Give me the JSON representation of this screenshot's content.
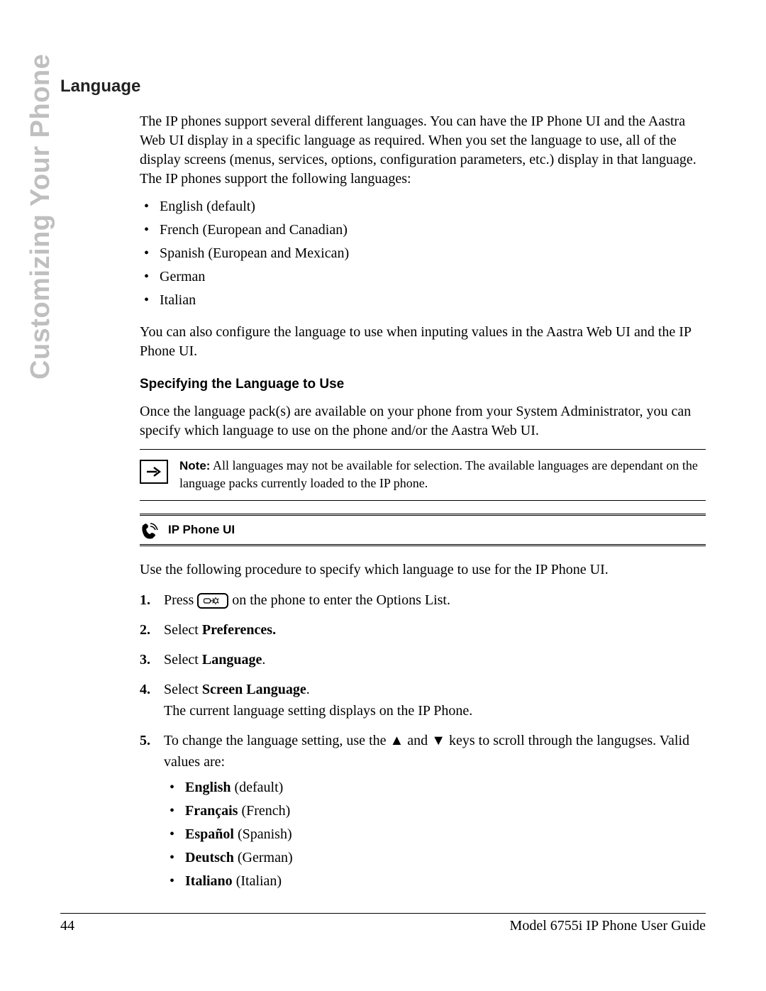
{
  "sidebar": {
    "title": "Customizing Your Phone"
  },
  "section": {
    "title": "Language",
    "intro": "The IP phones support several different languages. You can have the IP Phone UI and the Aastra Web UI display in a specific language as required. When you set the language to use, all of the display screens (menus, services, options, configuration parameters, etc.) display in that language. The IP phones support the following languages:",
    "lang_list": [
      "English (default)",
      "French (European and Canadian)",
      "Spanish (European and Mexican)",
      "German",
      "Italian"
    ],
    "post_list_para": "You can also configure the language to use when inputing values in the Aastra Web UI and the IP Phone UI."
  },
  "specify": {
    "heading": "Specifying the Language to Use",
    "para": "Once the language pack(s) are available on your phone from your System Administrator, you can specify which language to use on the phone and/or the Aastra Web UI."
  },
  "note": {
    "label": "Note:",
    "text": " All languages may not be available for selection. The available languages are dependant on the language packs currently loaded to the IP phone."
  },
  "ui_band": {
    "label": "IP Phone UI"
  },
  "procedure": {
    "intro": "Use the following procedure to specify which language to use for the IP Phone UI.",
    "steps": {
      "s1_pre": "Press ",
      "s1_post": " on the phone to enter the Options List.",
      "s2_pre": "Select ",
      "s2_bold": "Preferences.",
      "s3_pre": "Select ",
      "s3_bold": "Language",
      "s3_post": ".",
      "s4_pre": "Select ",
      "s4_bold": "Screen Language",
      "s4_post": ".",
      "s4_line2": "The current language setting displays on the IP Phone.",
      "s5_pre": "To change the language setting, use the ",
      "s5_mid": " and ",
      "s5_post": " keys to scroll through the langugses. Valid values are:",
      "values": [
        {
          "bold": "English",
          "rest": " (default)"
        },
        {
          "bold": "Français",
          "rest": " (French)"
        },
        {
          "bold": "Español",
          "rest": " (Spanish)"
        },
        {
          "bold": "Deutsch",
          "rest": " (German)"
        },
        {
          "bold": "Italiano",
          "rest": " (Italian)"
        }
      ]
    }
  },
  "footer": {
    "page": "44",
    "title": "Model 6755i IP Phone User Guide"
  },
  "glyphs": {
    "up": "▲",
    "down": "▼"
  }
}
